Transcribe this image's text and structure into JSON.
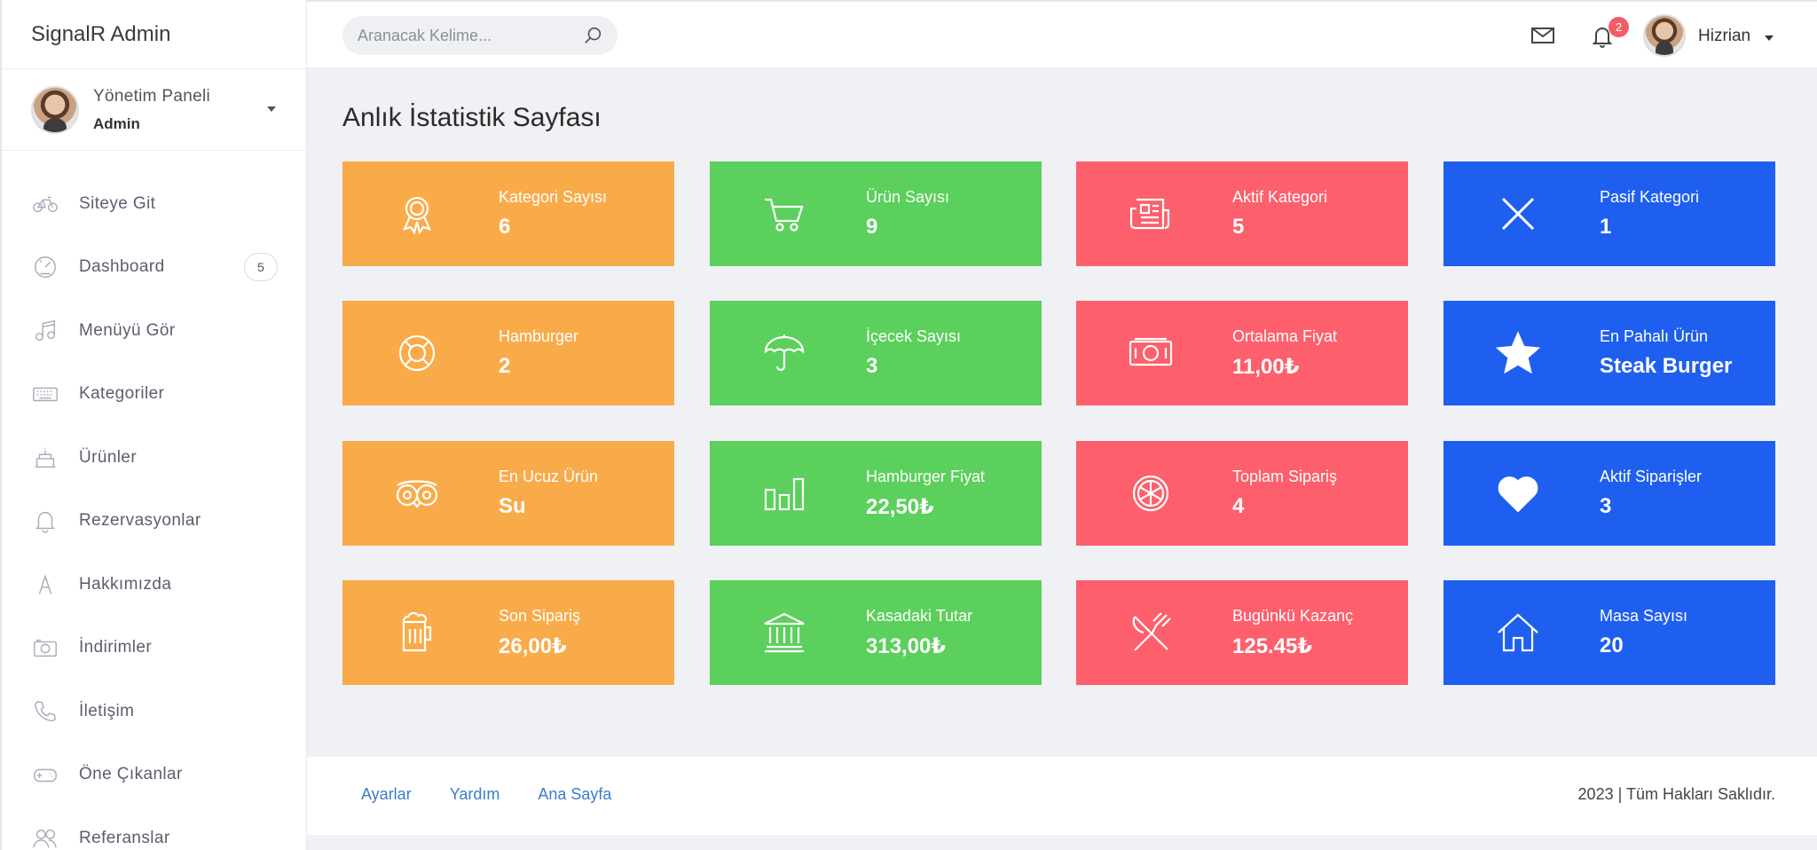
{
  "brand": "SignalR Admin",
  "profile": {
    "name": "Yönetim Paneli",
    "role": "Admin"
  },
  "nav": [
    {
      "label": "Siteye Git",
      "icon": "bicycle-icon"
    },
    {
      "label": "Dashboard",
      "icon": "speedometer-icon",
      "badge": "5"
    },
    {
      "label": "Menüyü Gör",
      "icon": "music-note-icon"
    },
    {
      "label": "Kategoriler",
      "icon": "keyboard-icon"
    },
    {
      "label": "Ürünler",
      "icon": "cake-icon"
    },
    {
      "label": "Rezervasyonlar",
      "icon": "bell-icon"
    },
    {
      "label": "Hakkımızda",
      "icon": "letter-a-icon"
    },
    {
      "label": "İndirimler",
      "icon": "camera-icon"
    },
    {
      "label": "İletişim",
      "icon": "phone-icon"
    },
    {
      "label": "Öne Çıkanlar",
      "icon": "gamepad-icon"
    },
    {
      "label": "Referanslar",
      "icon": "users-icon"
    }
  ],
  "search": {
    "placeholder": "Aranacak Kelime..."
  },
  "top": {
    "notification_count": "2",
    "user": "Hizrian"
  },
  "page_title": "Anlık İstatistik Sayfası",
  "cards": [
    {
      "label": "Kategori Sayısı",
      "value": "6",
      "color": "#f9ab4a",
      "icon": "award-icon"
    },
    {
      "label": "Ürün Sayısı",
      "value": "9",
      "color": "#5bd05c",
      "icon": "cart-icon"
    },
    {
      "label": "Aktif Kategori",
      "value": "5",
      "color": "#fd5f6c",
      "icon": "newspaper-icon"
    },
    {
      "label": "Pasif Kategori",
      "value": "1",
      "color": "#1f5ff0",
      "icon": "close-icon"
    },
    {
      "label": "Hamburger",
      "value": "2",
      "color": "#f9ab4a",
      "icon": "lifebuoy-icon"
    },
    {
      "label": "İçecek Sayısı",
      "value": "3",
      "color": "#5bd05c",
      "icon": "umbrella-icon"
    },
    {
      "label": "Ortalama Fiyat",
      "value": "11,00₺",
      "color": "#fd5f6c",
      "icon": "money-icon"
    },
    {
      "label": "En Pahalı Ürün",
      "value": "Steak Burger",
      "color": "#1f5ff0",
      "icon": "star-icon"
    },
    {
      "label": "En Ucuz Ürün",
      "value": "Su",
      "color": "#f9ab4a",
      "icon": "tripadvisor-icon"
    },
    {
      "label": "Hamburger Fiyat",
      "value": "22,50₺",
      "color": "#5bd05c",
      "icon": "bar-chart-icon"
    },
    {
      "label": "Toplam Sipariş",
      "value": "4",
      "color": "#fd5f6c",
      "icon": "lemon-icon"
    },
    {
      "label": "Aktif Siparişler",
      "value": "3",
      "color": "#1f5ff0",
      "icon": "heart-icon"
    },
    {
      "label": "Son Sipariş",
      "value": "26,00₺",
      "color": "#f9ab4a",
      "icon": "beer-icon"
    },
    {
      "label": "Kasadaki Tutar",
      "value": "313,00₺",
      "color": "#5bd05c",
      "icon": "bank-icon"
    },
    {
      "label": "Bugünkü Kazanç",
      "value": "125.45₺",
      "color": "#fd5f6c",
      "icon": "cutlery-icon"
    },
    {
      "label": "Masa Sayısı",
      "value": "20",
      "color": "#1f5ff0",
      "icon": "home-icon"
    }
  ],
  "footer": {
    "links": [
      "Ayarlar",
      "Yardım",
      "Ana Sayfa"
    ],
    "copyright": "2023 | Tüm Hakları Saklıdır."
  }
}
